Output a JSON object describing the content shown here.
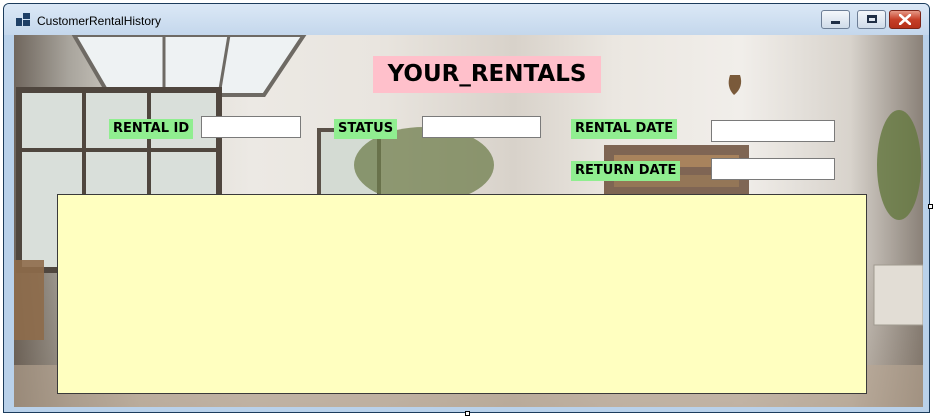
{
  "window": {
    "title": "CustomerRentalHistory",
    "controls": {
      "minimize_icon": "minimize-icon",
      "maximize_icon": "maximize-icon",
      "close_icon": "close-icon"
    }
  },
  "form": {
    "heading": "YOUR_RENTALS",
    "fields": {
      "rental_id": {
        "label": "RENTAL ID",
        "value": ""
      },
      "status": {
        "label": "STATUS",
        "value": ""
      },
      "rental_date": {
        "label": "RENTAL DATE",
        "value": ""
      },
      "return_date": {
        "label": "RETURN DATE",
        "value": ""
      }
    },
    "rentals_grid": {
      "rows": []
    }
  },
  "colors": {
    "heading_bg": "#ffc0cb",
    "label_bg": "#90ee90",
    "grid_bg": "#ffffc0"
  }
}
